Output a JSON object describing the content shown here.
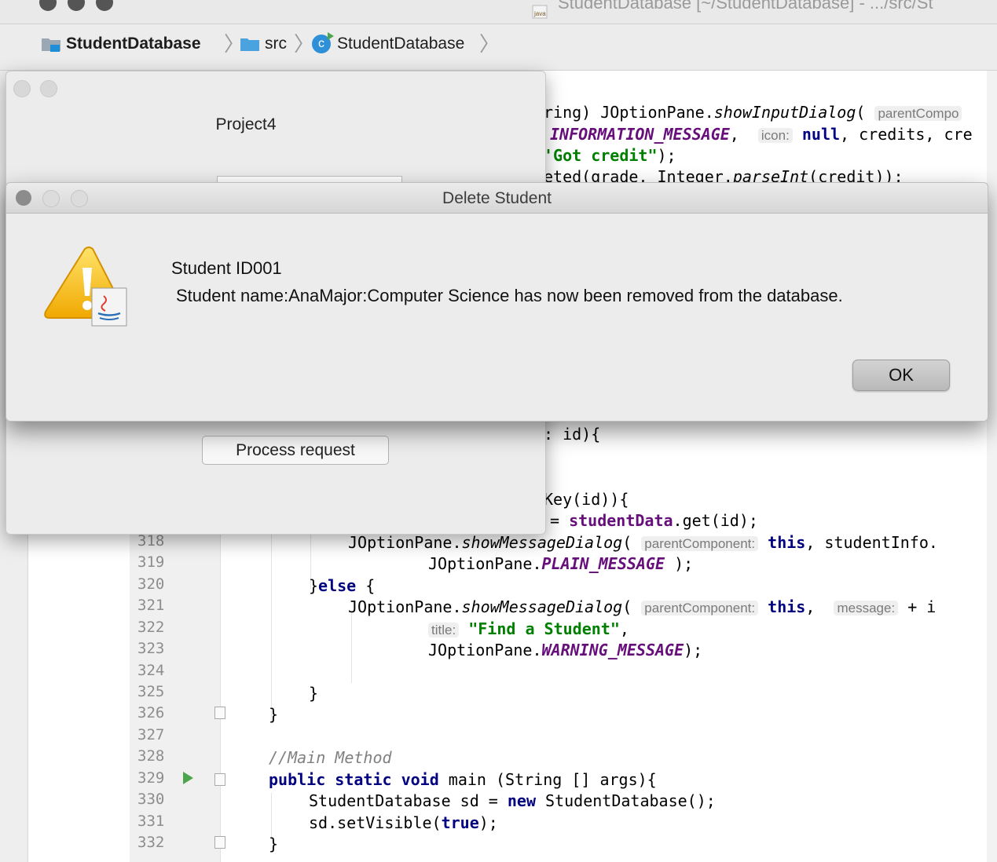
{
  "window": {
    "title": "StudentDatabase [~/StudentDatabase] - .../src/St"
  },
  "breadcrumb": {
    "project": "StudentDatabase",
    "folder": "src",
    "class_badge": "c",
    "file": "StudentDatabase"
  },
  "project_window": {
    "title": "Project4",
    "process_button": "Process request"
  },
  "dialog": {
    "title": "Delete Student",
    "line1": "Student ID001",
    "line2": "Student name:AnaMajor:Computer Science  has now been removed from the database.",
    "ok_label": "OK"
  },
  "code_fragments": {
    "r1a": "ring) JOptionPane.",
    "r1b": "showInputDialog",
    "r1c": "( ",
    "r1hint": "parentCompo",
    "r2a": "INFORMATION_MESSAGE",
    "r2b": ",  ",
    "r2hint": "icon:",
    "r2c": " null",
    "r2d": ", credits, cre",
    "r3a": "'Got credit\"",
    "r3b": ");",
    "r4a": "eted(grade, Integer.",
    "r4b": "parseInt",
    "r4c": "(credit));",
    "r5": ": id){",
    "r6": "Key(id)){",
    "r7a": "= ",
    "r7b": "studentData",
    "r7c": ".get(id);"
  },
  "line_numbers": [
    "318",
    "319",
    "320",
    "321",
    "322",
    "323",
    "324",
    "325",
    "326",
    "327",
    "328",
    "329",
    "330",
    "331",
    "332"
  ],
  "code_lines": {
    "l318a": "JOptionPane.",
    "l318b": "showMessageDialog",
    "l318c": "( ",
    "l318hint": "parentComponent:",
    "l318d": " this",
    "l318e": ", studentInfo.",
    "l319a": "JOptionPane.",
    "l319b": "PLAIN_MESSAGE",
    "l319c": " );",
    "l320a": "}",
    "l320b": "else",
    "l320c": " {",
    "l321a": "JOptionPane.",
    "l321b": "showMessageDialog",
    "l321c": "( ",
    "l321hint": "parentComponent:",
    "l321d": " this",
    "l321e": ",  ",
    "l321hint2": "message:",
    "l321f": " + i",
    "l322hint": "title:",
    "l322a": " \"Find a Student\"",
    "l322b": ",",
    "l323a": "JOptionPane.",
    "l323b": "WARNING_MESSAGE",
    "l323c": ");",
    "l325": "}",
    "l326": "}",
    "l328": "//Main Method",
    "l329a": "public static void",
    "l329b": " main (String [] args){",
    "l330a": "StudentDatabase sd = ",
    "l330b": "new",
    "l330c": " StudentDatabase();",
    "l331a": "sd.setVisible(",
    "l331b": "true",
    "l331c": ");",
    "l332": "}"
  },
  "colors": {
    "keyword": "#000080",
    "field": "#660e7a",
    "string": "#008000",
    "comment": "#808080",
    "run_icon": "#4ca54c"
  }
}
